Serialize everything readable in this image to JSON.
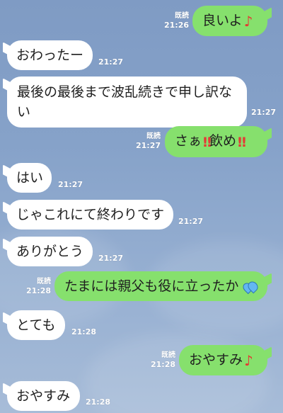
{
  "messages": [
    {
      "side": "out",
      "text": "良いよ",
      "emoji": "♪",
      "read": "既読",
      "time": "21:26"
    },
    {
      "side": "in",
      "text": "おわったー",
      "time": "21:27"
    },
    {
      "side": "in",
      "text": "最後の最後まで波乱続きで申し訳ない",
      "time": "21:27"
    },
    {
      "side": "out",
      "text": "さぁ",
      "emoji": "‼",
      "text2": "飲め",
      "emoji2": "‼",
      "read": "既読",
      "time": "21:27"
    },
    {
      "side": "in",
      "text": "はい",
      "time": "21:27"
    },
    {
      "side": "in",
      "text": "じゃこれにて終わりです",
      "time": "21:27"
    },
    {
      "side": "in",
      "text": "ありがとう",
      "time": "21:27"
    },
    {
      "side": "out",
      "text": "たまには親父も役に立ったか",
      "emoji": "sweat-droplets",
      "read": "既読",
      "time": "21:28"
    },
    {
      "side": "in",
      "text": "とても",
      "time": "21:28"
    },
    {
      "side": "out",
      "text": "おやすみ",
      "emoji": "♪",
      "read": "既読",
      "time": "21:28"
    },
    {
      "side": "in",
      "text": "おやすみ",
      "time": "21:28"
    }
  ],
  "colors": {
    "outgoing_bubble": "#86e06d",
    "incoming_bubble": "#ffffff",
    "background": "#86a2c9"
  }
}
